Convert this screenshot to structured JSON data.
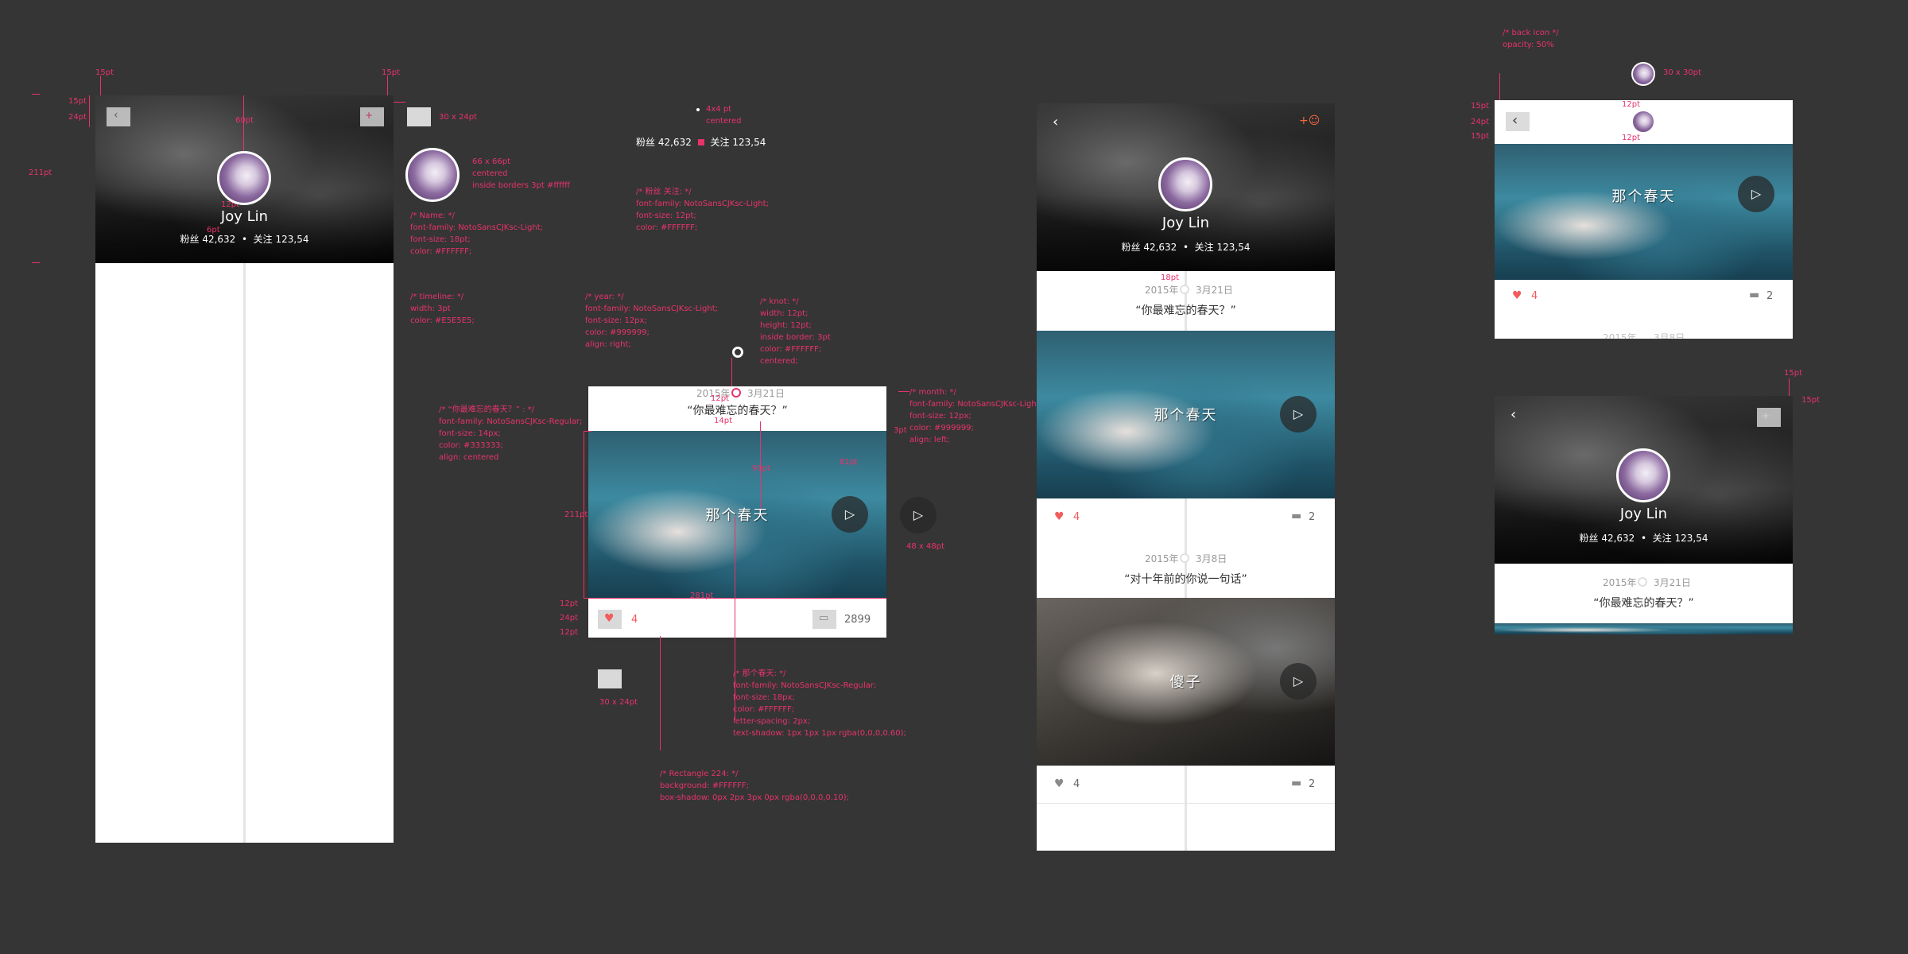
{
  "profile": {
    "name": "Joy Lin",
    "fans_label": "粉丝",
    "fans": "42,632",
    "follow_label": "关注",
    "follows": "123,54",
    "separator": "•"
  },
  "posts": [
    {
      "year": "2015年",
      "date": "3月21日",
      "question": "“你最难忘的春天？”",
      "video_title": "那个春天",
      "likes": "4",
      "comments": "2"
    },
    {
      "year": "2015年",
      "date": "3月8日",
      "question": "“对十年前的你说一句话”",
      "video_title": "傻子",
      "likes": "4",
      "comments": "2"
    }
  ],
  "spec_card": {
    "year": "2015年",
    "date": "3月21日",
    "question": "“你最难忘的春天？”",
    "video_title": "那个春天",
    "likes": "4",
    "comments": "2899"
  },
  "annotations": {
    "back_icon": "/* back icon */\nopacity: 50%",
    "avatar_30": "30 x 30pt",
    "btn_30x24": "30 x 24pt",
    "avatar_66": "66 x 66pt\ncentered\ninside borders 3pt #ffffff",
    "name_style": "/* Name: */\nfont-family: NotoSansCJKsc-Light;\nfont-size: 18pt;\ncolor: #FFFFFF;",
    "timeline_style": "/* timeline: */\nwidth: 3pt\ncolor: #E5E5E5;",
    "dot": "4x4 pt\ncentered",
    "stats_style": "/* 粉丝 关注: */\nfont-family: NotoSansCJKsc-Light;\nfont-size: 12pt;\ncolor: #FFFFFF;",
    "year_style": "/* year: */\nfont-family: NotoSansCJKsc-Light;\nfont-size: 12px;\ncolor: #999999;\nalign: right;",
    "knot_style": "/* knot: */\nwidth: 12pt;\nheight: 12pt;\ninside border: 3pt\ncolor: #FFFFFF;\ncentered;",
    "question_style": "/* “你最难忘的春天？” : */\nfont-family: NotoSansCJKsc-Regular;\nfont-size: 14px;\ncolor: #333333;\nalign: centered",
    "month_style": "/* month: */\nfont-family: NotoSansCJKsc-Light;\nfont-size: 12px;\ncolor: #999999;\nalign: left;",
    "video_title_style": "/* 那个春天: */\nfont-family: NotoSansCJKsc-Regular;\nfont-size: 18px;\ncolor: #FFFFFF;\nletter-spacing: 2px;\ntext-shadow: 1px 1px 1px rgba(0,0,0,0.60);",
    "rect_style": "/* Rectangle 224: */\nbackground: #FFFFFF;\nbox-shadow: 0px 2px 3px 0px rgba(0,0,0,0.10);",
    "play_size": "48 x 48pt",
    "btn_30x24_b": "30 x 24pt"
  },
  "dims": {
    "d15": "15pt",
    "d24": "24pt",
    "d211": "211pt",
    "d60": "60pt",
    "d12": "12pt",
    "d6": "6pt",
    "d14": "14pt",
    "d81": "81pt",
    "d90": "90pt",
    "d281": "281pt",
    "d3": "3pt",
    "d18": "18pt",
    "d10": "10pt"
  }
}
